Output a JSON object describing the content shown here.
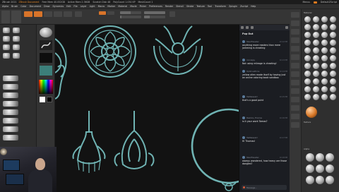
{
  "titlebar": {
    "app": "ZBrush 2021",
    "path": "ZBrush Document",
    "mem": "Free Mem 40.052GB",
    "active": "Active Mem 2.36GB",
    "scratch": "Scratch Disk 48",
    "polys": "PolyCount 1.034 KP",
    "mesh": "MeshCount 1",
    "menus_label": "Menus",
    "default_script": "DefaultZScript"
  },
  "menubar": {
    "items": [
      "Alpha",
      "Brush",
      "Color",
      "Document",
      "Draw",
      "Dynamics",
      "Edit",
      "File",
      "Layer",
      "Light",
      "Macro",
      "Marker",
      "Material",
      "Movie",
      "Picker",
      "Preferences",
      "Render",
      "Stencil",
      "Stroke",
      "Texture",
      "Tool",
      "Transform",
      "Zplugin",
      "Zscript",
      "Help"
    ]
  },
  "toolbar": {
    "home": "Home Page",
    "lightbox": "LightBox",
    "edit": "Edit",
    "draw": "Draw",
    "move": "Move",
    "scale": "Scale",
    "rotate": "Rotate",
    "zadd": "Zadd",
    "zsub": "Zsub",
    "focal": "Focal Shift 0",
    "draw_size": "Draw Size 64",
    "z_intensity": "Z Intensity 25",
    "rgb_intensity": "Rgb Intensity 100",
    "focal_value": 0,
    "draw_size_value": 64,
    "z_intensity_value": 25,
    "rgb_intensity_value": 100
  },
  "chat": {
    "title": "Pop Out",
    "messages": [
      {
        "user": "SteelTraveller",
        "time": "10:12 PM",
        "text": "anything more readers than mere jamming is cheating"
      },
      {
        "user": "ronniejay",
        "time": "10:13 PM",
        "text": "Not using mileage is cheating!"
      },
      {
        "user": "OptimusPrime",
        "time": "10:14 PM",
        "text": "yellow alien made itself by having just an online coloring book sandbox"
      },
      {
        "user": "HeMakesArt",
        "time": "10:15 PM",
        "text": "that's a good point"
      },
      {
        "user": "Pewkins_Thomas",
        "time": "10:16 PM",
        "text": "is it your work Tomas?"
      },
      {
        "user": "HeMakesArt",
        "time": "10:17 PM",
        "text": "Hi Thomas!"
      },
      {
        "user": "SteelTraveller",
        "time": "10:18 PM",
        "text": "always wondered, how heavy are those dangles?"
      }
    ],
    "input_placeholder": "Message..."
  },
  "rightpanel": {
    "section1": "Material",
    "section2": "Texture",
    "section3": "Alpha",
    "labels": [
      "Subtool",
      "Geometry",
      "Polypaint",
      "Masking",
      "Visibility",
      "Deformation",
      "Morph"
    ]
  },
  "colors": {
    "accent": "#e07a1f",
    "curve": "#6fb3b3",
    "canvas": "#121212",
    "chat_bg": "#1b1d22"
  }
}
